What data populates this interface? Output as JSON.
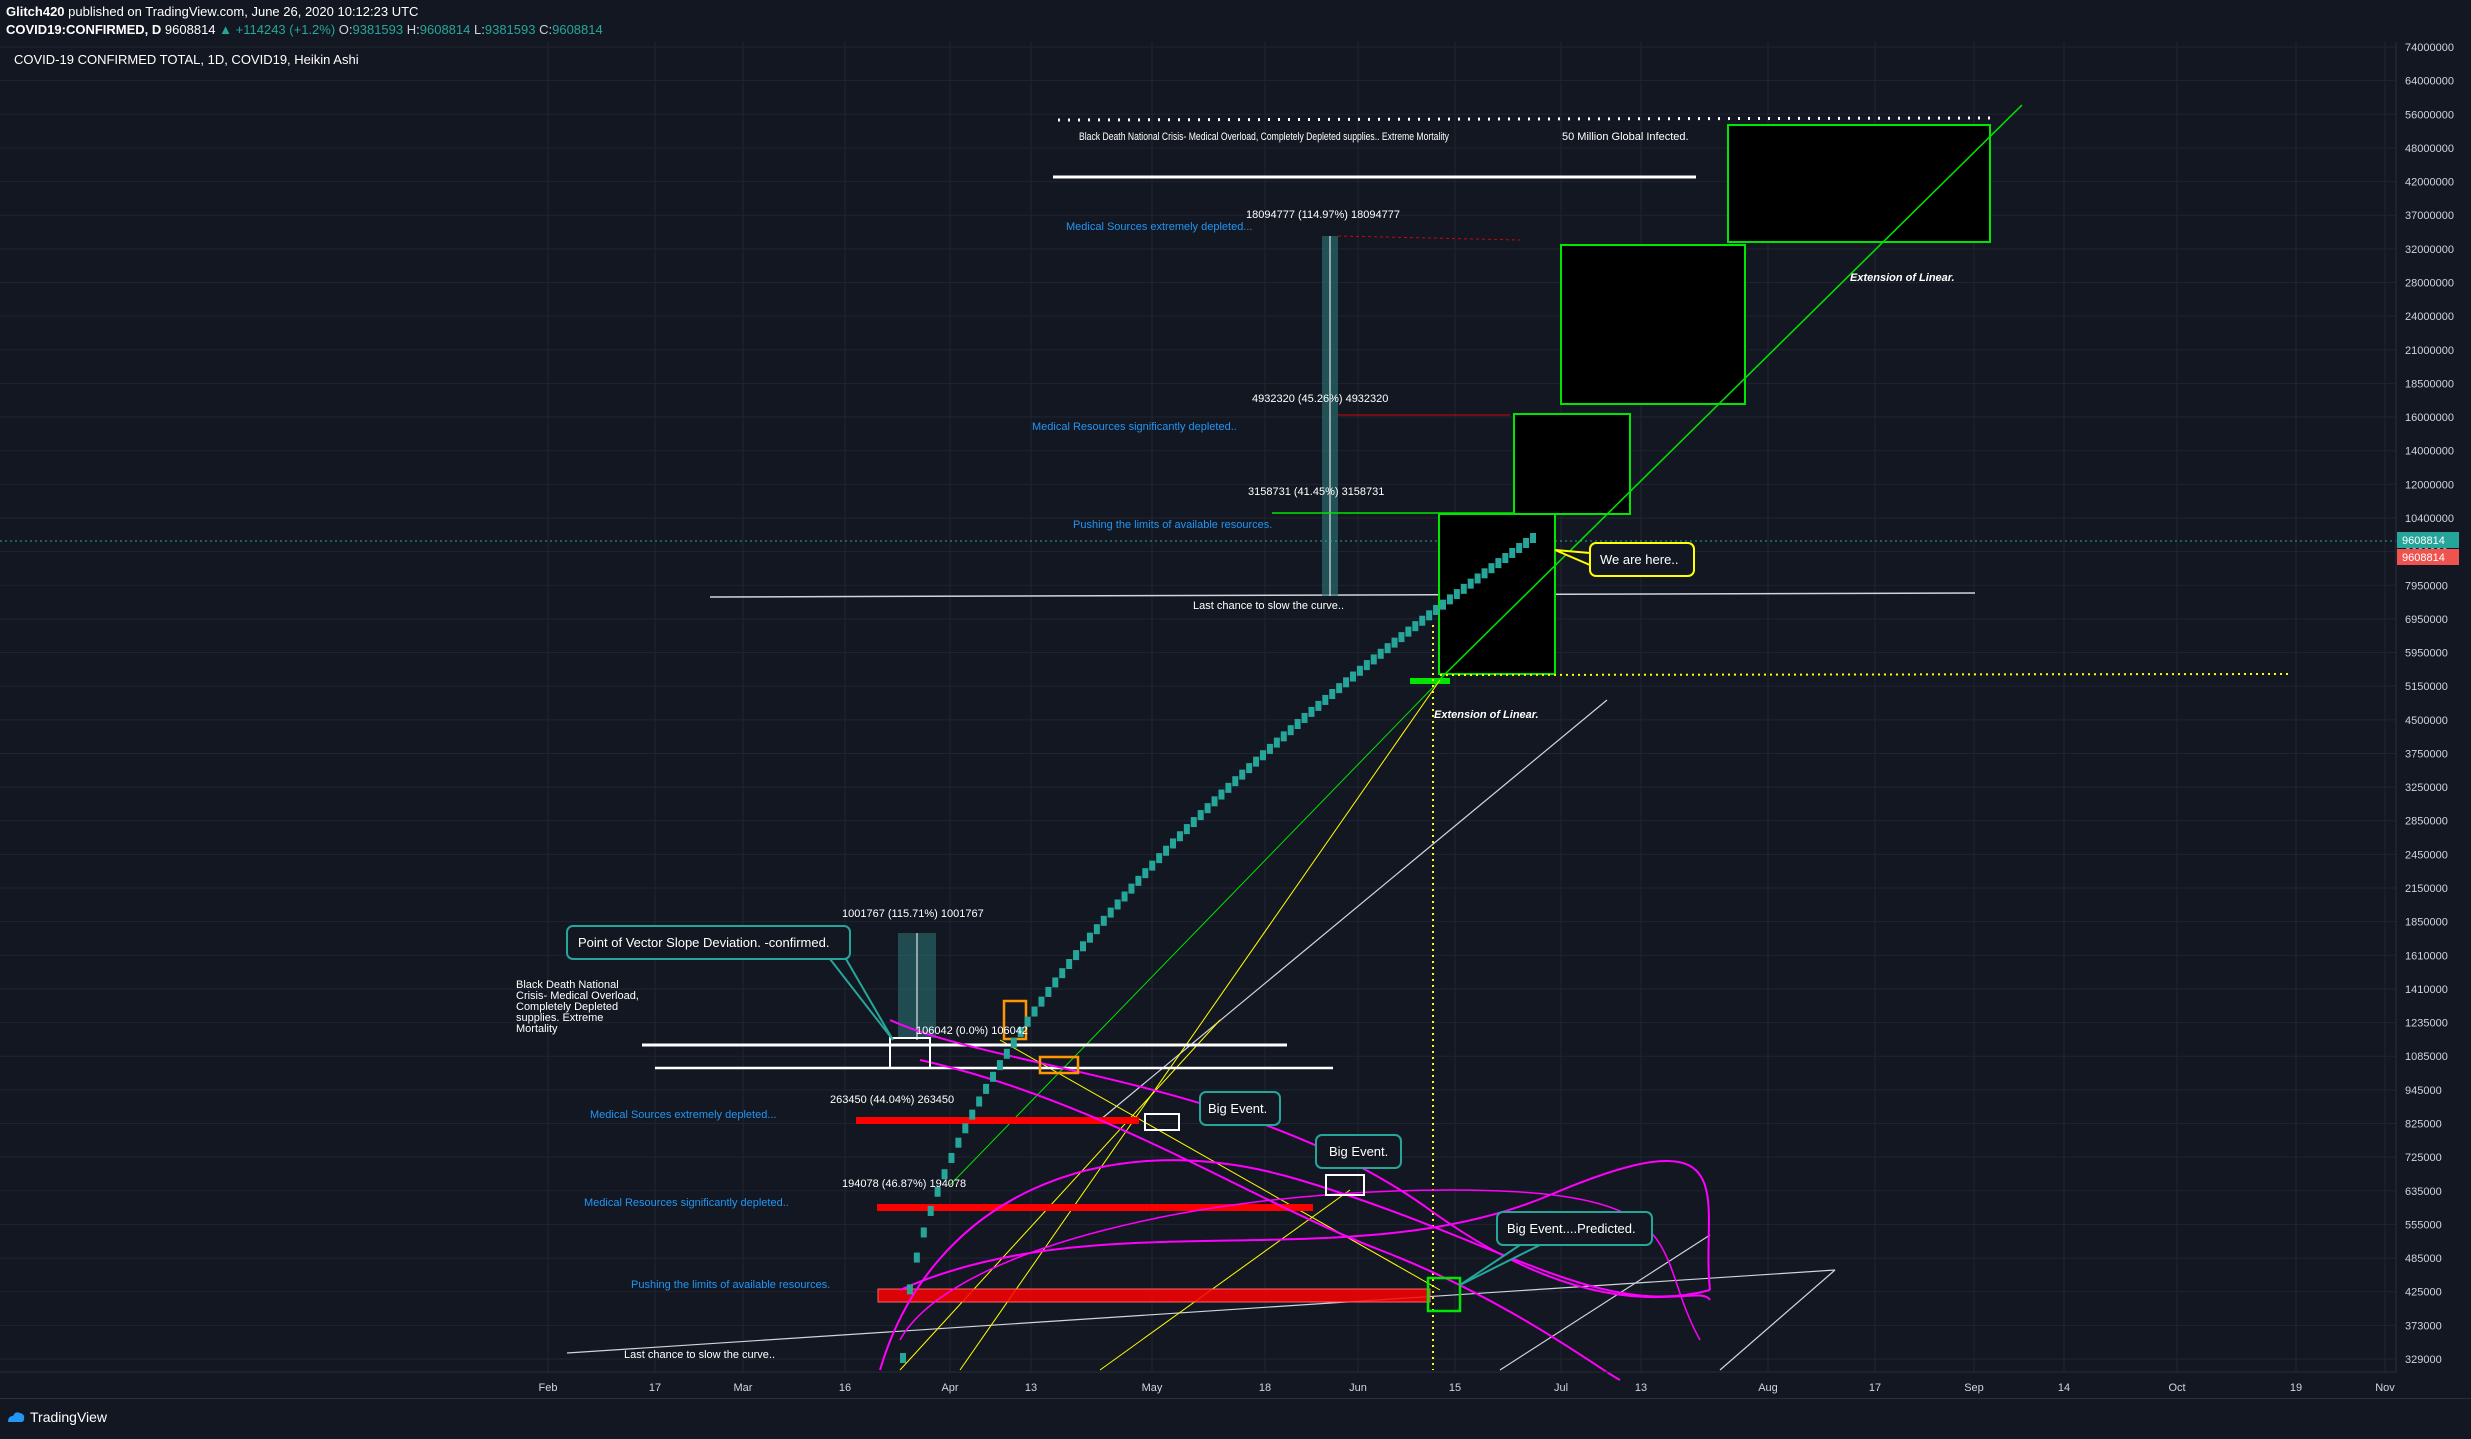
{
  "header": {
    "author": "Glitch420",
    "published": " published on TradingView.com, June 26, 2020 10:12:23 UTC",
    "symbol": "COVID19:CONFIRMED, D",
    "last": "9608814",
    "change": "▲ +114243 (+1.2%)",
    "o_label": "O:",
    "o": "9381593",
    "h_label": "H:",
    "h": "9608814",
    "l_label": "L:",
    "l": "9381593",
    "c_label": "C:",
    "c": "9608814"
  },
  "pane_title": "COVID-19 CONFIRMED TOTAL, 1D, COVID19, Heikin Ashi",
  "footer": {
    "brand": "TradingView"
  },
  "colors": {
    "background": "#131722",
    "grid": "#1f2430",
    "candle": "#26a69a",
    "magenta": "#ff00ff",
    "green": "#00e600",
    "yellow": "#ffff00",
    "red": "#ff0000",
    "orange": "#ff9800",
    "blue_text": "#2196f3"
  },
  "chart_data": {
    "type": "candlestick",
    "style": "Heikin Ashi",
    "y_scale": "log",
    "y_ticks": [
      "74000000",
      "64000000",
      "56000000",
      "48000000",
      "42000000",
      "37000000",
      "32000000",
      "28000000",
      "24000000",
      "21000000",
      "18500000",
      "16000000",
      "14000000",
      "12000000",
      "10400000",
      "9000000",
      "7950000",
      "6950000",
      "5950000",
      "5150000",
      "4500000",
      "3750000",
      "3250000",
      "2850000",
      "2450000",
      "2150000",
      "1850000",
      "1610000",
      "1410000",
      "1235000",
      "1085000",
      "945000",
      "825000",
      "725000",
      "635000",
      "555000",
      "485000",
      "425000",
      "373000",
      "329000"
    ],
    "x_ticks": [
      "Feb",
      "17",
      "Mar",
      "16",
      "Apr",
      "13",
      "May",
      "18",
      "Jun",
      "15",
      "Jul",
      "13",
      "Aug",
      "17",
      "Sep",
      "14",
      "Oct",
      "19",
      "Nov"
    ],
    "last_price_labels": [
      "9608814",
      "9608814"
    ],
    "series": [
      {
        "name": "COVID19:CONFIRMED",
        "start": "2020-03-20",
        "end": "2020-06-26",
        "start_value": 280000,
        "end_value": 9608814
      }
    ],
    "annotations_upper": {
      "black_death": "Black Death National Crisis- Medical Overload, Completely Depleted supplies.. Extreme Mortality",
      "fifty_million": "50 Million Global Infected.",
      "measure_top": "18094777 (114.97%) 18094777",
      "medical_extremely": "Medical Sources extremely depleted...",
      "measure_mid": "4932320 (45.26%) 4932320",
      "medical_significantly": "Medical Resources significantly depleted..",
      "measure_low": "3158731 (41.45%) 3158731",
      "pushing_limits": "Pushing the limits of available resources.",
      "last_chance": "Last chance to slow the curve..",
      "extension_linear": "Extension of Linear.",
      "we_are_here": "We are here.."
    },
    "annotations_lower": {
      "black_death": "Black Death National Crisis- Medical Overload, Completely Depleted supplies. Extreme Mortality",
      "measure_top": "1001767 (115.71%) 1001767",
      "vector_slope": "Point of Vector Slope Deviation. -confirmed.",
      "measure_mid": "106042 (0.0%) 106042",
      "measure_a": "263450 (44.04%) 263450",
      "medical_extremely": "Medical Sources extremely depleted...",
      "measure_b": "194078 (46.87%) 194078",
      "medical_significantly": "Medical Resources significantly depleted..",
      "pushing_limits": "Pushing the limits of available resources.",
      "last_chance": "Last chance to slow the curve..",
      "big_event_1": "Big Event.",
      "big_event_2": "Big Event.",
      "big_event_3": "Big Event....Predicted.",
      "extension_linear": "Extension of Linear."
    }
  }
}
